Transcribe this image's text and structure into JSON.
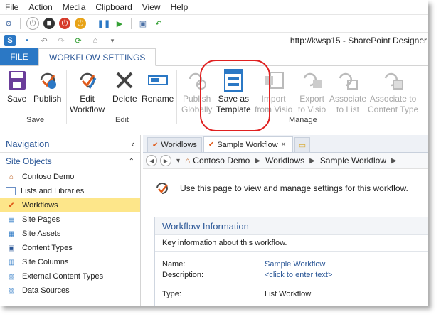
{
  "menu": [
    "File",
    "Action",
    "Media",
    "Clipboard",
    "View",
    "Help"
  ],
  "window_title": "http://kwsp15 - SharePoint Designer",
  "ribbon_tabs": {
    "file": "FILE",
    "active": "WORKFLOW SETTINGS"
  },
  "ribbon": {
    "save": {
      "label": "Save",
      "group": "Save"
    },
    "publish": "Publish",
    "edit_workflow_1": "Edit",
    "edit_workflow_2": "Workflow",
    "delete": "Delete",
    "rename": "Rename",
    "edit_group": "Edit",
    "publish_globally_1": "Publish",
    "publish_globally_2": "Globally",
    "save_as_template_1": "Save as",
    "save_as_template_2": "Template",
    "import_1": "Import",
    "import_2": "from Visio",
    "export_1": "Export",
    "export_2": "to Visio",
    "assoc_list_1": "Associate",
    "assoc_list_2": "to List",
    "assoc_ct_1": "Associate to",
    "assoc_ct_2": "Content Type",
    "manage_group": "Manage"
  },
  "nav": {
    "title": "Navigation",
    "section": "Site Objects",
    "items": [
      "Contoso Demo",
      "Lists and Libraries",
      "Workflows",
      "Site Pages",
      "Site Assets",
      "Content Types",
      "Site Columns",
      "External Content Types",
      "Data Sources"
    ]
  },
  "doc_tabs": [
    "Workflows",
    "Sample Workflow"
  ],
  "breadcrumb": [
    "Contoso Demo",
    "Workflows",
    "Sample Workflow"
  ],
  "intro_text": "Use this page to view and manage settings for this workflow.",
  "info": {
    "title": "Workflow Information",
    "subtitle": "Key information about this workflow.",
    "name_label": "Name:",
    "name_value": "Sample Workflow",
    "desc_label": "Description:",
    "desc_value": "<click to enter text>",
    "type_label": "Type:",
    "type_value": "List Workflow"
  },
  "colors": {
    "accent": "#2b78c5",
    "link": "#2b5797",
    "selected": "#fde68a",
    "highlight_circle": "#e02020"
  }
}
